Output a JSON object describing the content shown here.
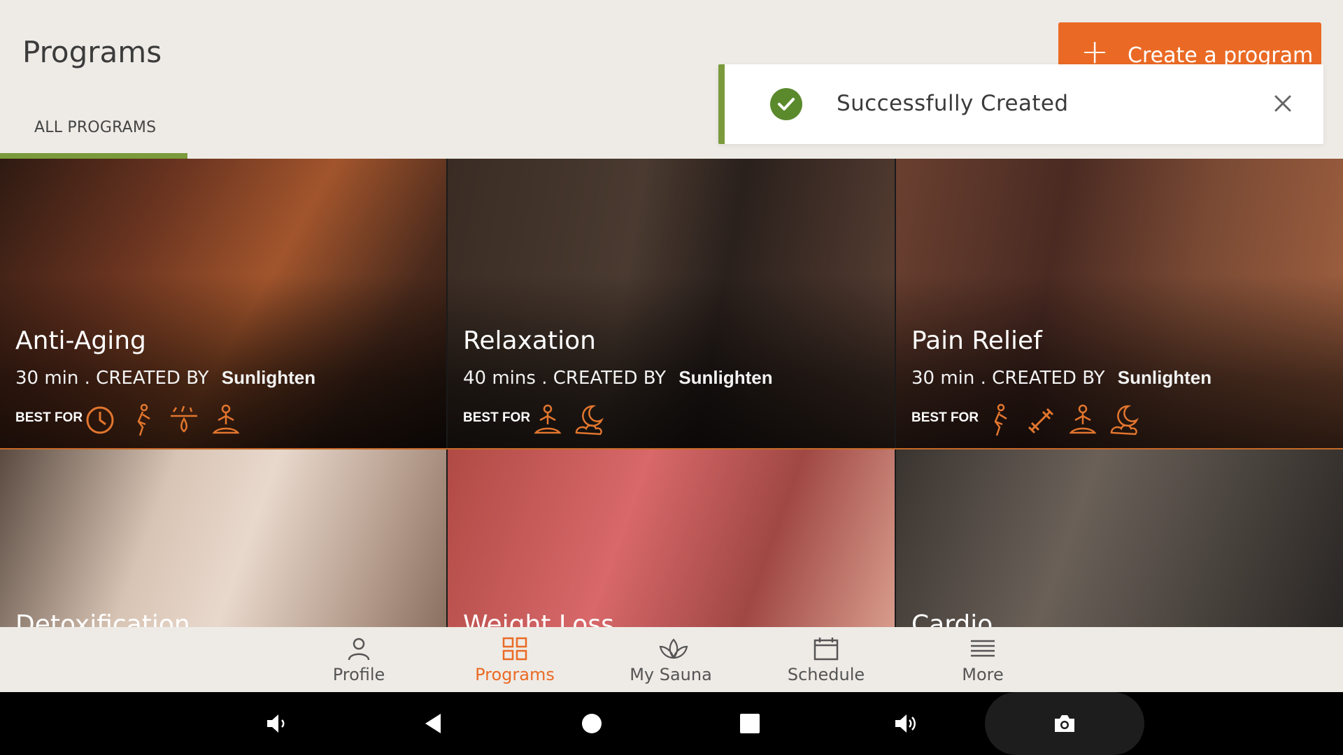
{
  "header": {
    "title": "Programs",
    "tab_label": "ALL PROGRAMS",
    "create_button_label": "Create a program",
    "accent_color": "#ea6a25",
    "tab_underline_color": "#7a9a3c"
  },
  "toast": {
    "message": "Successfully Created",
    "status_icon": "check-circle-icon",
    "status_color": "#5b8a2d"
  },
  "programs": [
    {
      "title": "Anti-Aging",
      "duration": "30 min",
      "created_by_label": ". CREATED BY",
      "creator": "Sunlighten",
      "best_for_label": "BEST FOR",
      "best_for_icons": [
        "timer-icon",
        "anti-aging-figure-icon",
        "detox-drops-icon",
        "meditation-icon"
      ]
    },
    {
      "title": "Relaxation",
      "duration": "40 mins",
      "created_by_label": ". CREATED BY",
      "creator": "Sunlighten",
      "best_for_label": "BEST FOR",
      "best_for_icons": [
        "meditation-icon",
        "sleep-moon-icon"
      ]
    },
    {
      "title": "Pain Relief",
      "duration": "30 min",
      "created_by_label": ". CREATED BY",
      "creator": "Sunlighten",
      "best_for_label": "BEST FOR",
      "best_for_icons": [
        "anti-aging-figure-icon",
        "dumbbell-icon",
        "meditation-icon",
        "sleep-moon-icon"
      ]
    },
    {
      "title": "Detoxification"
    },
    {
      "title": "Weight Loss"
    },
    {
      "title": "Cardio"
    }
  ],
  "bottom_nav": {
    "items": [
      {
        "label": "Profile",
        "icon": "person-icon"
      },
      {
        "label": "Programs",
        "icon": "grid-icon",
        "active": true
      },
      {
        "label": "My Sauna",
        "icon": "lotus-icon"
      },
      {
        "label": "Schedule",
        "icon": "calendar-icon"
      },
      {
        "label": "More",
        "icon": "menu-lines-icon"
      }
    ]
  },
  "system_bar": {
    "buttons": [
      "volume-down-icon",
      "back-icon",
      "home-icon",
      "recents-icon",
      "volume-up-icon",
      "camera-icon"
    ]
  }
}
